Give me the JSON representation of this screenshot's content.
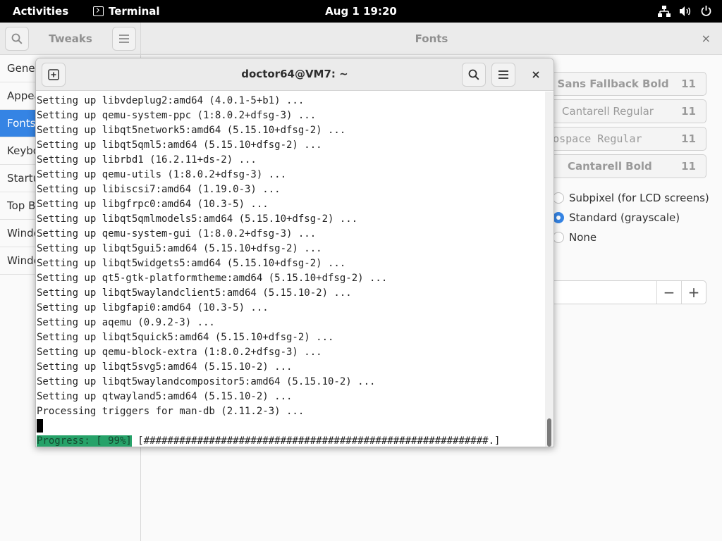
{
  "topbar": {
    "activities": "Activities",
    "app_name": "Terminal",
    "clock": "Aug 1  19:20",
    "tray_icons": [
      "network-icon",
      "volume-icon",
      "power-icon"
    ]
  },
  "tweaks": {
    "app_title": "Tweaks",
    "page_title": "Fonts",
    "close_glyph": "×",
    "sidebar": [
      {
        "label": "General",
        "selected": false
      },
      {
        "label": "Appearance",
        "selected": false
      },
      {
        "label": "Fonts",
        "selected": true
      },
      {
        "label": "Keyboard & Mouse",
        "selected": false
      },
      {
        "label": "Startup Applications",
        "selected": false
      },
      {
        "label": "Top Bar",
        "selected": false
      },
      {
        "label": "Window Titlebars",
        "selected": false
      },
      {
        "label": "Windows",
        "selected": false
      }
    ],
    "fonts": [
      {
        "name": "Noto Sans Fallback Bold",
        "size": "11"
      },
      {
        "name": "Cantarell Regular",
        "size": "11"
      },
      {
        "name": "Monospace Regular",
        "size": "11"
      },
      {
        "name": "Cantarell Bold",
        "size": "11"
      }
    ],
    "antialiasing": [
      {
        "label": "Subpixel (for LCD screens)",
        "checked": false
      },
      {
        "label": "Standard (grayscale)",
        "checked": true
      },
      {
        "label": "None",
        "checked": false
      }
    ],
    "scaling": {
      "minus": "−",
      "plus": "+"
    }
  },
  "terminal": {
    "title": "doctor64@VM7: ~",
    "lines": [
      "Setting up libvdeplug2:amd64 (4.0.1-5+b1) ...",
      "Setting up qemu-system-ppc (1:8.0.2+dfsg-3) ...",
      "Setting up libqt5network5:amd64 (5.15.10+dfsg-2) ...",
      "Setting up libqt5qml5:amd64 (5.15.10+dfsg-2) ...",
      "Setting up librbd1 (16.2.11+ds-2) ...",
      "Setting up qemu-utils (1:8.0.2+dfsg-3) ...",
      "Setting up libiscsi7:amd64 (1.19.0-3) ...",
      "Setting up libgfrpc0:amd64 (10.3-5) ...",
      "Setting up libqt5qmlmodels5:amd64 (5.15.10+dfsg-2) ...",
      "Setting up qemu-system-gui (1:8.0.2+dfsg-3) ...",
      "Setting up libqt5gui5:amd64 (5.15.10+dfsg-2) ...",
      "Setting up libqt5widgets5:amd64 (5.15.10+dfsg-2) ...",
      "Setting up qt5-gtk-platformtheme:amd64 (5.15.10+dfsg-2) ...",
      "Setting up libqt5waylandclient5:amd64 (5.15.10-2) ...",
      "Setting up libgfapi0:amd64 (10.3-5) ...",
      "Setting up aqemu (0.9.2-3) ...",
      "Setting up libqt5quick5:amd64 (5.15.10+dfsg-2) ...",
      "Setting up qemu-block-extra (1:8.0.2+dfsg-3) ...",
      "Setting up libqt5svg5:amd64 (5.15.10-2) ...",
      "Setting up libqt5waylandcompositor5:amd64 (5.15.10-2) ...",
      "Setting up qtwayland5:amd64 (5.15.10-2) ...",
      "Processing triggers for man-db (2.11.2-3) ..."
    ],
    "progress_label": "Progress: [ 99%]",
    "progress_bar": " [##########################################################.]",
    "progress_percent": 99
  }
}
